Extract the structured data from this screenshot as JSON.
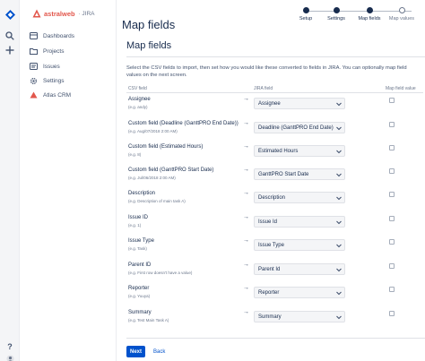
{
  "brand": {
    "name": "astralweb",
    "product": "JIRA"
  },
  "rail": {
    "icons": [
      "search-icon",
      "create-icon",
      "help-icon",
      "avatar"
    ],
    "help_glyph": "?"
  },
  "sidebar": {
    "items": [
      {
        "label": "Dashboards",
        "icon": "dashboard-icon"
      },
      {
        "label": "Projects",
        "icon": "folder-icon"
      },
      {
        "label": "Issues",
        "icon": "issues-icon"
      },
      {
        "label": "Settings",
        "icon": "gear-icon"
      },
      {
        "label": "Atlas CRM",
        "icon": "crm-icon"
      }
    ]
  },
  "header": {
    "title": "Map fields"
  },
  "steps": [
    {
      "label": "Setup",
      "done": true
    },
    {
      "label": "Settings",
      "done": true
    },
    {
      "label": "Map fields",
      "done": true
    },
    {
      "label": "Map values",
      "done": false
    }
  ],
  "main": {
    "title": "Map fields",
    "intro": "Select the CSV fields to import, then set how you would like these converted to fields in JIRA. You can optionally map field values on the next screen.",
    "col_csv": "CSV field",
    "col_jira": "JIRA field",
    "col_map": "Map field value",
    "arrow": "→",
    "rows": [
      {
        "csv": "Assignee",
        "example": "(e.g. andy)",
        "jira": "Assignee"
      },
      {
        "csv": "Custom field (Deadline (GanttPRO End Date))",
        "example": "(e.g. Aug/07/2018 2:00 AM)",
        "jira": "Deadline (GanttPRO End Date)"
      },
      {
        "csv": "Custom field (Estimated Hours)",
        "example": "(e.g. 8)",
        "jira": "Estimated Hours"
      },
      {
        "csv": "Custom field (GanttPRO Start Date)",
        "example": "(e.g. Jul/06/2018 2:00 AM)",
        "jira": "GanttPRO Start Date"
      },
      {
        "csv": "Description",
        "example": "(e.g. Description of main task A)",
        "jira": "Description"
      },
      {
        "csv": "Issue ID",
        "example": "(e.g. 1)",
        "jira": "Issue Id"
      },
      {
        "csv": "Issue Type",
        "example": "(e.g. Task)",
        "jira": "Issue Type"
      },
      {
        "csv": "Parent ID",
        "example": "(e.g. First row doesn't have a value)",
        "jira": "Parent Id"
      },
      {
        "csv": "Reporter",
        "example": "(e.g. Yuuya)",
        "jira": "Reporter"
      },
      {
        "csv": "Summary",
        "example": "(e.g. Test Main Task A)",
        "jira": "Summary"
      }
    ]
  },
  "footer": {
    "next_label": "Next",
    "back_label": "Back"
  },
  "colors": {
    "primary": "#0052cc",
    "brand_red": "#e2574c",
    "text": "#172b4d"
  }
}
